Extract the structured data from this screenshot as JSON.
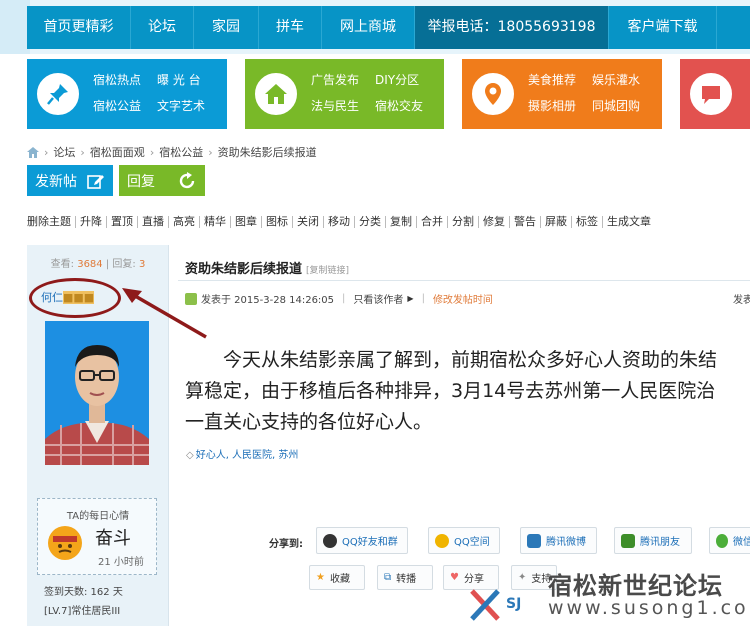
{
  "nav": {
    "items": [
      "首页更精彩",
      "论坛",
      "家园",
      "拼车",
      "网上商城",
      "举报电话：18055693198",
      "客户端下载"
    ]
  },
  "tiles": [
    {
      "color": "#0b9bd6",
      "icon": "pushpin-icon",
      "links": [
        "宿松热点",
        "曝 光 台",
        "宿松公益",
        "文字艺术"
      ]
    },
    {
      "color": "#79b928",
      "icon": "home-icon",
      "links": [
        "广告发布",
        "DIY分区",
        "法与民生",
        "宿松交友"
      ]
    },
    {
      "color": "#f07c1b",
      "icon": "map-pin-icon",
      "links": [
        "美食推荐",
        "娱乐灌水",
        "摄影相册",
        "同城团购"
      ]
    },
    {
      "color": "#e2524f",
      "icon": "chat-icon",
      "links": [
        "",
        "",
        "",
        ""
      ]
    }
  ],
  "breadcrumb": [
    "论坛",
    "宿松面面观",
    "宿松公益",
    "资助朱结影后续报道"
  ],
  "actions": {
    "new_post": "发新帖",
    "reply": "回复"
  },
  "modbar": [
    "删除主题",
    "升降",
    "置顶",
    "直播",
    "高亮",
    "精华",
    "图章",
    "图标",
    "关闭",
    "移动",
    "分类",
    "复制",
    "合并",
    "分割",
    "修复",
    "警告",
    "屏蔽",
    "标签",
    "生成文章"
  ],
  "stats": {
    "views_label": "查看:",
    "views": "3684",
    "replies_label": "回复:",
    "replies": "3"
  },
  "user": {
    "name_prefix": "何仁",
    "name_blurred": "■■■",
    "mood_title": "TA的每日心情",
    "mood_word": "奋斗",
    "mood_time": "21 小时前",
    "sign_days": "签到天数: 162 天",
    "level": "[LV.7]常住居民III"
  },
  "post": {
    "title": "资助朱结影后续报道",
    "copy_link": "[复制链接]",
    "posted_at": "发表于 2015-3-28 14:26:05",
    "only_author": "只看该作者",
    "edit_time": "修改发帖时间",
    "right_meta": "发表",
    "content_lines": [
      "今天从朱结影亲属了解到，前期宿松众多好心人资助的朱结",
      "算稳定，由于移植后各种排异，3月14号去苏州第一人民医院治",
      "一直关心支持的各位好心人。"
    ],
    "tags": "好心人, 人民医院, 苏州"
  },
  "share": {
    "label": "分享到:",
    "buttons": [
      "QQ好友和群",
      "QQ空间",
      "腾讯微博",
      "腾讯朋友",
      "微信"
    ]
  },
  "post_actions": [
    "收藏",
    "转播",
    "分享",
    "支持"
  ],
  "watermark": {
    "cn": "宿松新世纪论坛",
    "url": "www.susong1.com",
    "sj": "SJ"
  }
}
